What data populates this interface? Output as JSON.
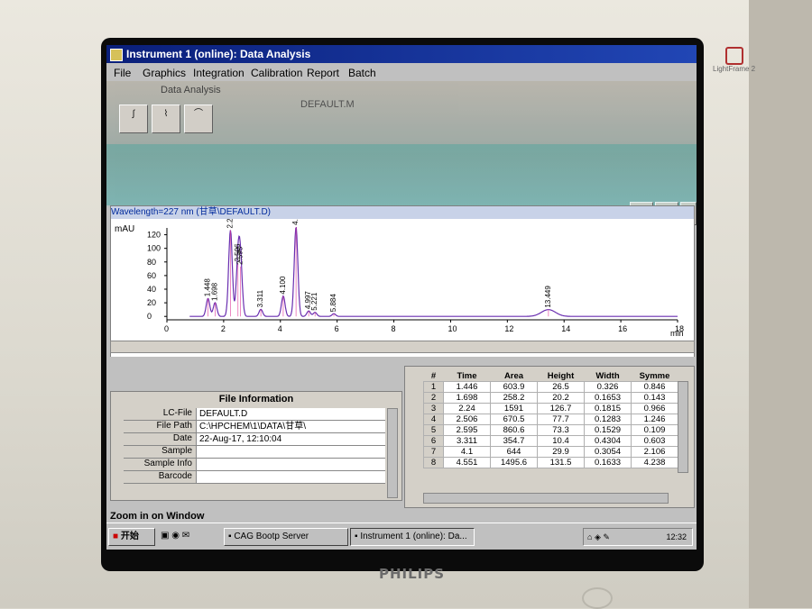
{
  "window": {
    "title": "Instrument 1 (online): Data Analysis"
  },
  "menu": [
    "File",
    "Graphics",
    "Integration",
    "Calibration",
    "Report",
    "Batch"
  ],
  "toolbar": {
    "view_label": "Data Analysis",
    "method_label": "DEFAULT.M"
  },
  "chart": {
    "header": "Wavelength=227 nm (甘草\\DEFAULT.D)",
    "ylabel": "mAU",
    "xunit": "min"
  },
  "chart_data": {
    "type": "line",
    "title": "",
    "xlabel": "",
    "ylabel": "mAU",
    "xlim": [
      0,
      18
    ],
    "ylim": [
      -5,
      130
    ],
    "xticks": [
      0,
      2,
      4,
      6,
      8,
      10,
      12,
      14,
      16,
      18
    ],
    "yticks": [
      0,
      20,
      40,
      60,
      80,
      100,
      120
    ],
    "grid": false,
    "peaks": [
      {
        "label": "1.448",
        "x": 1.448,
        "y": 26.5
      },
      {
        "label": "1.698",
        "x": 1.698,
        "y": 20.2
      },
      {
        "label": "2.240",
        "x": 2.24,
        "y": 126.7
      },
      {
        "label": "2.506",
        "x": 2.506,
        "y": 77.7
      },
      {
        "label": "2.595",
        "x": 2.595,
        "y": 73.3
      },
      {
        "label": "3.311",
        "x": 3.311,
        "y": 10.4
      },
      {
        "label": "4.100",
        "x": 4.1,
        "y": 29.9
      },
      {
        "label": "4.551",
        "x": 4.551,
        "y": 131.5
      },
      {
        "label": "4.997",
        "x": 4.997,
        "y": 8
      },
      {
        "label": "5.221",
        "x": 5.221,
        "y": 6
      },
      {
        "label": "5.884",
        "x": 5.884,
        "y": 4
      },
      {
        "label": "13.449",
        "x": 13.449,
        "y": 10
      }
    ]
  },
  "file_info": {
    "title": "File Information",
    "rows": [
      {
        "key": "LC-File",
        "value": "DEFAULT.D"
      },
      {
        "key": "File Path",
        "value": "C:\\HPCHEM\\1\\DATA\\甘草\\"
      },
      {
        "key": "Date",
        "value": "22-Aug-17, 12:10:04"
      },
      {
        "key": "Sample",
        "value": ""
      },
      {
        "key": "Sample Info",
        "value": ""
      },
      {
        "key": "Barcode",
        "value": ""
      }
    ]
  },
  "peak_table": {
    "columns": [
      "#",
      "Time",
      "Area",
      "Height",
      "Width",
      "Symme"
    ],
    "rows": [
      [
        "1",
        "1.446",
        "603.9",
        "26.5",
        "0.326",
        "0.846"
      ],
      [
        "2",
        "1.698",
        "258.2",
        "20.2",
        "0.1653",
        "0.143"
      ],
      [
        "3",
        "2.24",
        "1591",
        "126.7",
        "0.1815",
        "0.966"
      ],
      [
        "4",
        "2.506",
        "670.5",
        "77.7",
        "0.1283",
        "1.246"
      ],
      [
        "5",
        "2.595",
        "860.6",
        "73.3",
        "0.1529",
        "0.109"
      ],
      [
        "6",
        "3.311",
        "354.7",
        "10.4",
        "0.4304",
        "0.603"
      ],
      [
        "7",
        "4.1",
        "644",
        "29.9",
        "0.3054",
        "2.106"
      ],
      [
        "8",
        "4.551",
        "1495.6",
        "131.5",
        "0.1633",
        "4.238"
      ]
    ]
  },
  "status": {
    "text": "Zoom in on Window"
  },
  "taskbar": {
    "start": "开始",
    "tasks": [
      "CAG Bootp Server",
      "Instrument 1 (online): Da..."
    ],
    "clock": "12:32"
  },
  "bezel": {
    "brand": "PHILIPS",
    "badge": "LightFrame 2"
  }
}
